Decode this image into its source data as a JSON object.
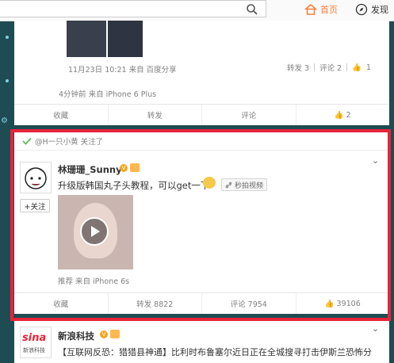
{
  "topbar": {
    "home_label": "首页",
    "discover_label": "发现",
    "accent": "#fa7d3c"
  },
  "post1": {
    "embedded_meta": "11月23日 10:21 来自 百度分享",
    "embedded_actions": {
      "repost": "转发 3",
      "comment": "评论 2",
      "like": "1"
    },
    "meta": "4分钟前 来自 iPhone 6 Plus",
    "actions": {
      "collect": "收藏",
      "repost": "转发",
      "comment": "评论",
      "like": "2"
    }
  },
  "post2": {
    "recommend_text": "@H一只小黄 关注了",
    "username": "林珊珊_Sunny",
    "text": "升级版韩国丸子头教程，可以get一下",
    "tag": "秒拍视频",
    "follow_label": "+关注",
    "meta": "推荐 来自 iPhone 6s",
    "actions": {
      "collect": "收藏",
      "repost": "转发 8822",
      "comment": "评论 7954",
      "like": "39106"
    }
  },
  "post3": {
    "username": "新浪科技",
    "text_line1": "【互联网反恐：猎猎县神通】比利时布鲁塞尔近日正在全城搜寻打击伊斯兰恐怖分",
    "avatar_text": "sina",
    "avatar_sub": "新浪科技"
  },
  "colors": {
    "frame": "#e8243b",
    "background": "#1f4b52",
    "verified": "#f5a623"
  }
}
